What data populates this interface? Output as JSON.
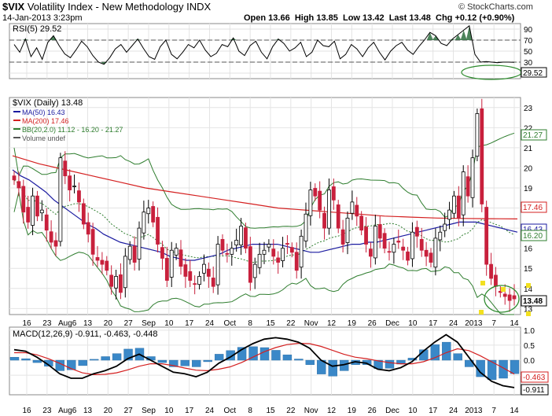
{
  "header": {
    "symbol": "$VIX",
    "name": "Volatility Index - New Methodology",
    "exchange": "INDX",
    "watermark": "© StockCharts.com",
    "date": "14-Jan-2013 3:23pm",
    "open": "Open 13.66",
    "high": "High 13.85",
    "low": "Low 13.42",
    "last": "Last 13.48",
    "chg": "Chg +0.12 (+0.90%)"
  },
  "x_labels": [
    "16",
    "23",
    "Aug6",
    "13",
    "20",
    "27",
    "Sep",
    "10",
    "17",
    "24",
    "Oct",
    "8",
    "15",
    "22",
    "Nov",
    "12",
    "19",
    "26",
    "Dec",
    "10",
    "17",
    "24",
    "2013",
    "7",
    "14"
  ],
  "chart_data": [
    {
      "type": "line",
      "panel": "RSI",
      "title": "RSI(5) 29.52",
      "last_value": "29.52",
      "yticks": [
        "90",
        "70",
        "50",
        "30",
        "10"
      ],
      "ylim": [
        0,
        100
      ],
      "levels": [
        70,
        30
      ],
      "series": [
        {
          "name": "RSI(5)",
          "values": [
            62,
            48,
            72,
            40,
            56,
            35,
            66,
            78,
            60,
            45,
            38,
            52,
            68,
            58,
            42,
            30,
            26,
            38,
            54,
            62,
            48,
            60,
            72,
            55,
            40,
            35,
            58,
            70,
            44,
            36,
            48,
            62,
            56,
            70,
            52,
            40,
            46,
            62,
            58,
            74,
            50,
            42,
            60,
            68,
            48,
            36,
            58,
            72,
            64,
            50,
            56,
            66,
            40,
            48,
            70,
            60,
            58,
            68,
            36,
            44,
            62,
            54,
            40,
            56,
            66,
            48,
            34,
            50,
            60,
            66,
            52,
            44,
            58,
            70,
            84,
            78,
            64,
            60,
            72,
            80,
            88,
            96,
            44,
            30,
            31,
            30,
            29,
            30,
            30,
            29.52
          ]
        }
      ]
    },
    {
      "type": "candlestick",
      "panel": "Price",
      "title": "$VIX (Daily) 13.48",
      "legend": [
        "MA(50) 16.43",
        "MA(200) 17.46",
        "BB(20,2.0) 11.12 - 16.20 - 21.27",
        "Volume undef"
      ],
      "yticks": [
        "23",
        "22",
        "21",
        "20",
        "19",
        "18",
        "17",
        "16",
        "15",
        "14",
        "13"
      ],
      "ylim": [
        12.7,
        23.5
      ],
      "value_tags": [
        "21.27",
        "17.46",
        "16.43",
        "16.20",
        "13.48"
      ],
      "last_value": "13.48",
      "series": [
        {
          "name": "Close",
          "values": [
            19.4,
            19.0,
            17.8,
            17.3,
            18.6,
            17.6,
            17.9,
            16.9,
            16.3,
            16.1,
            20.5,
            19.6,
            18.9,
            19.1,
            18.3,
            17.2,
            16.7,
            15.7,
            15.4,
            15.2,
            14.9,
            14.1,
            14.6,
            13.8,
            15.6,
            16.1,
            15.3,
            17.0,
            17.8,
            18.0,
            17.3,
            16.2,
            15.5,
            14.4,
            15.9,
            16.0,
            15.1,
            14.6,
            14.4,
            14.2,
            14.6,
            15.2,
            14.6,
            14.1,
            16.2,
            15.9,
            15.7,
            16.0,
            16.4,
            17.1,
            16.0,
            14.3,
            15.2,
            15.7,
            15.9,
            16.2,
            15.6,
            15.3,
            16.0,
            16.2,
            15.8,
            14.9,
            16.6,
            17.7,
            18.9,
            18.6,
            17.9,
            17.0,
            18.9,
            18.4,
            17.0,
            16.2,
            17.5,
            18.3,
            17.6,
            16.9,
            16.2,
            15.6,
            17.1,
            16.5,
            16.0,
            15.8,
            16.2,
            16.3,
            15.9,
            15.4,
            16.8,
            16.6,
            15.9,
            15.6,
            15.3,
            16.5,
            16.8,
            17.2,
            17.9,
            18.6,
            17.5,
            19.8,
            18.6,
            20.5,
            22.7,
            18.2,
            15.2,
            14.5,
            14.1,
            13.8,
            13.6,
            13.4,
            13.48
          ]
        },
        {
          "name": "MA(50)",
          "values": [
            19.9,
            19.6,
            19.4,
            19.1,
            18.8,
            18.4,
            18.1,
            17.8,
            17.5,
            17.2,
            17.0,
            16.7,
            16.5,
            16.3,
            16.2,
            16.1,
            16.0,
            15.9,
            15.8,
            15.6,
            15.5,
            15.4,
            15.4,
            15.5,
            15.6,
            15.7,
            15.9,
            16.0,
            16.1,
            16.2,
            16.2,
            16.2,
            16.2,
            16.1,
            16.0,
            15.9,
            15.8,
            15.8,
            15.9,
            16.0,
            16.1,
            16.2,
            16.2,
            16.3,
            16.3,
            16.4,
            16.5,
            16.6,
            16.7,
            16.8,
            16.9,
            17.0,
            17.1,
            17.2,
            17.3,
            17.3,
            17.3,
            17.2,
            17.1,
            17.0,
            16.9,
            16.8
          ]
        },
        {
          "name": "MA(200)",
          "values": [
            20.6,
            20.2,
            19.9,
            19.6,
            19.3,
            19.0,
            18.8,
            18.6,
            18.4,
            18.2,
            18.0,
            17.9,
            17.8,
            17.7,
            17.6,
            17.55,
            17.5,
            17.48,
            17.47,
            17.46
          ]
        }
      ]
    },
    {
      "type": "line",
      "panel": "MACD",
      "title": "MACD(12,26,9) -0.911, -0.463, -0.448",
      "yticks": [
        "1.0",
        "0.5",
        "0.0",
        "-0.5"
      ],
      "ylim": [
        -1.15,
        1.1
      ],
      "value_tags": [
        "-0.463",
        "-0.911"
      ],
      "series": [
        {
          "name": "MACD",
          "values": [
            0.35,
            0.3,
            0.1,
            -0.15,
            -0.45,
            -0.6,
            -0.6,
            -0.45,
            -0.35,
            -0.2,
            0.05,
            0.2,
            0.0,
            -0.2,
            -0.4,
            -0.45,
            -0.55,
            -0.4,
            -0.1,
            0.1,
            0.35,
            0.55,
            0.7,
            0.75,
            0.7,
            0.6,
            0.4,
            0.0,
            -0.2,
            -0.15,
            -0.05,
            -0.1,
            -0.3,
            -0.35,
            -0.25,
            -0.05,
            0.3,
            0.6,
            0.85,
            0.6,
            0.1,
            -0.4,
            -0.7,
            -0.85,
            -0.911
          ]
        },
        {
          "name": "Signal",
          "values": [
            0.25,
            0.25,
            0.18,
            0.05,
            -0.1,
            -0.28,
            -0.42,
            -0.48,
            -0.47,
            -0.42,
            -0.32,
            -0.2,
            -0.12,
            -0.12,
            -0.18,
            -0.26,
            -0.33,
            -0.35,
            -0.3,
            -0.22,
            -0.08,
            0.1,
            0.28,
            0.42,
            0.52,
            0.56,
            0.55,
            0.46,
            0.33,
            0.2,
            0.1,
            0.05,
            -0.02,
            -0.08,
            -0.12,
            -0.12,
            -0.05,
            0.08,
            0.25,
            0.38,
            0.32,
            0.15,
            -0.05,
            -0.25,
            -0.463
          ]
        },
        {
          "name": "Histogram",
          "values": [
            0.1,
            0.05,
            -0.08,
            -0.2,
            -0.35,
            -0.32,
            -0.18,
            0.03,
            0.12,
            0.22,
            0.37,
            0.4,
            0.12,
            -0.08,
            -0.22,
            -0.19,
            -0.22,
            -0.05,
            0.2,
            0.32,
            0.43,
            0.45,
            0.42,
            0.33,
            0.18,
            0.04,
            -0.15,
            -0.46,
            -0.53,
            -0.35,
            -0.15,
            -0.15,
            -0.28,
            -0.27,
            -0.13,
            0.07,
            0.35,
            0.52,
            0.6,
            0.22,
            -0.22,
            -0.55,
            -0.65,
            -0.6,
            -0.448
          ]
        }
      ]
    }
  ],
  "colors": {
    "ma50": "#1a1aa0",
    "ma200": "#d42020",
    "bb": "#2e7d2e",
    "up": "#000000",
    "down": "#c8203c",
    "hist": "#3a88c8",
    "rsi_fill": "#2e6e3e"
  }
}
